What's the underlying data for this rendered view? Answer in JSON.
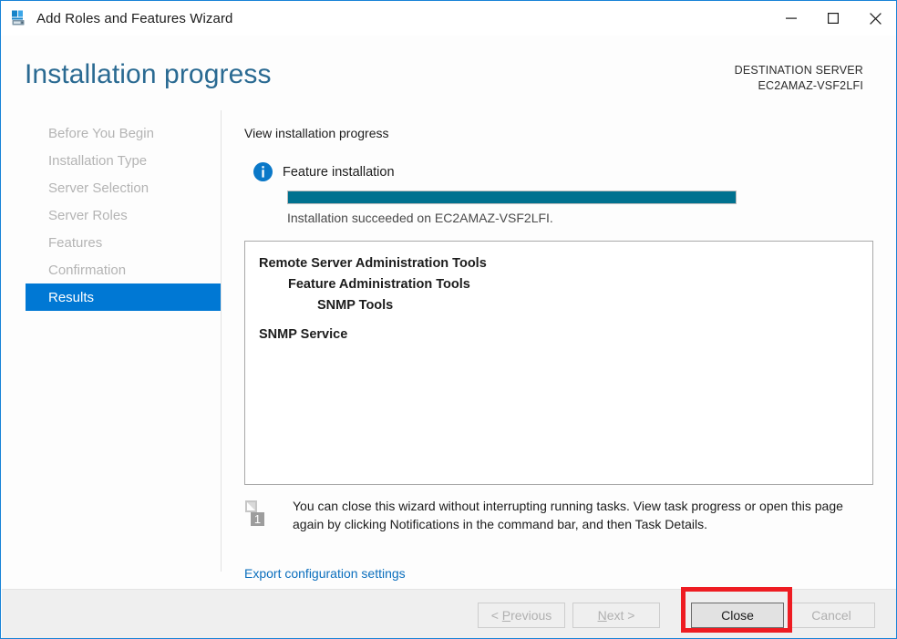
{
  "window": {
    "title": "Add Roles and Features Wizard",
    "app_icon": "server-rack-icon",
    "controls": {
      "minimize": "minimize-icon",
      "maximize": "maximize-icon",
      "close": "close-icon"
    },
    "accent_color": "#1883d7"
  },
  "header": {
    "heading": "Installation progress",
    "destination_label": "DESTINATION SERVER",
    "destination_server": "EC2AMAZ-VSF2LFI",
    "heading_color": "#2a6a92"
  },
  "sidebar": {
    "items": [
      {
        "label": "Before You Begin",
        "selected": false
      },
      {
        "label": "Installation Type",
        "selected": false
      },
      {
        "label": "Server Selection",
        "selected": false
      },
      {
        "label": "Server Roles",
        "selected": false
      },
      {
        "label": "Features",
        "selected": false
      },
      {
        "label": "Confirmation",
        "selected": false
      },
      {
        "label": "Results",
        "selected": true
      }
    ],
    "selected_color": "#0078d4",
    "disabled_color": "#b4b4b4"
  },
  "main": {
    "section_label": "View installation progress",
    "status_icon": "info-icon",
    "status_title": "Feature installation",
    "progress": {
      "percent": 100,
      "fill_color": "#00718f"
    },
    "progress_status": "Installation succeeded on EC2AMAZ-VSF2LFI.",
    "features": [
      {
        "label": "Remote Server Administration Tools",
        "level": 0,
        "gap_before": false
      },
      {
        "label": "Feature Administration Tools",
        "level": 1,
        "gap_before": false
      },
      {
        "label": "SNMP Tools",
        "level": 2,
        "gap_before": false
      },
      {
        "label": "SNMP Service",
        "level": 0,
        "gap_before": true
      }
    ],
    "notice_icon": "notification-flag-icon",
    "notice_badge": "1",
    "notice_text": "You can close this wizard without interrupting running tasks. View task progress or open this page again by clicking Notifications in the command bar, and then Task Details.",
    "export_link": "Export configuration settings",
    "link_color": "#0a6ebd"
  },
  "footer": {
    "buttons": [
      {
        "id": "previous",
        "prefix": "< ",
        "mnemonic": "P",
        "suffix": "revious",
        "enabled": false
      },
      {
        "id": "next",
        "prefix": "",
        "mnemonic": "N",
        "suffix": "ext >",
        "enabled": false
      },
      {
        "id": "close",
        "label": "Close",
        "enabled": true
      },
      {
        "id": "cancel",
        "label": "Cancel",
        "enabled": false
      }
    ]
  },
  "annotation": {
    "target": "close-button",
    "color": "#ee1c22"
  }
}
